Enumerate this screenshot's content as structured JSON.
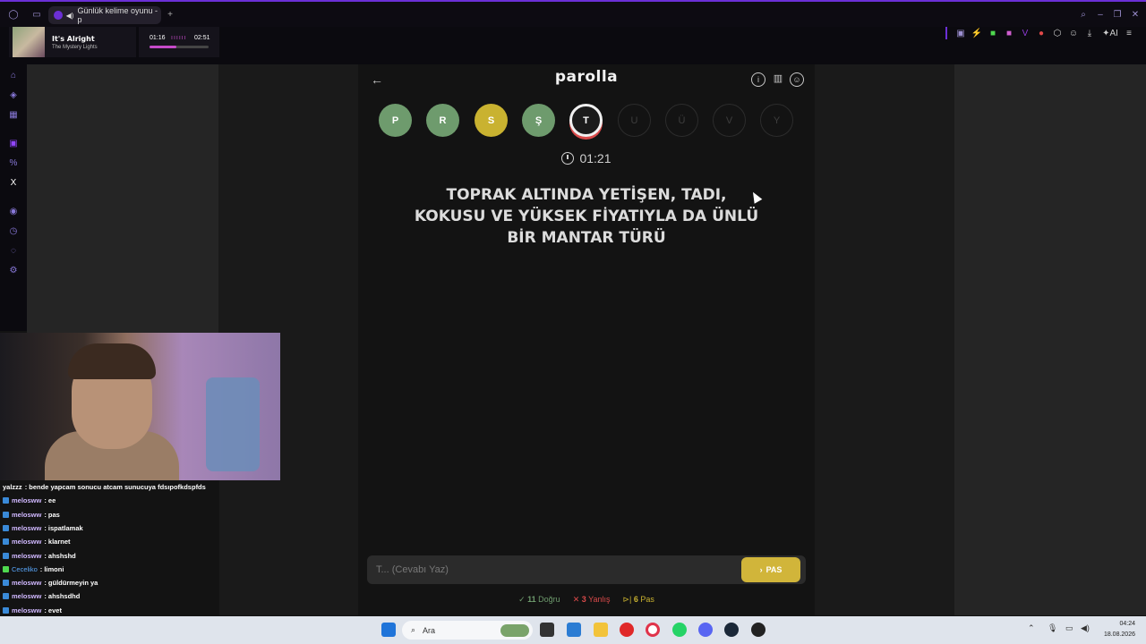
{
  "browser": {
    "tab_title": "Günlük kelime oyunu - p"
  },
  "player": {
    "title": "It's Alright",
    "artist": "The Mystery Lights",
    "elapsed": "01:16",
    "duration": "02:51",
    "progress": 0.45
  },
  "game": {
    "brand": "parolla",
    "letters": [
      {
        "char": "P",
        "state": "correct"
      },
      {
        "char": "R",
        "state": "correct"
      },
      {
        "char": "S",
        "state": "passed"
      },
      {
        "char": "Ş",
        "state": "correct"
      },
      {
        "char": "T",
        "state": "current"
      },
      {
        "char": "U",
        "state": "pending"
      },
      {
        "char": "Ü",
        "state": "pending"
      },
      {
        "char": "V",
        "state": "pending"
      },
      {
        "char": "Y",
        "state": "pending"
      }
    ],
    "timer": "01:21",
    "question": "TOPRAK ALTINDA YETİŞEN, TADI, KOKUSU VE YÜKSEK FİYATIYLA DA ÜNLÜ BİR MANTAR TÜRÜ",
    "answer_placeholder": "T... (Cevabı Yaz)",
    "pass_button": "PAS",
    "stats": {
      "correct_count": "11",
      "correct_label": "Doğru",
      "wrong_count": "3",
      "wrong_label": "Yanlış",
      "pass_count": "6",
      "pass_label": "Pas"
    },
    "colors": {
      "correct": "#6e9b6d",
      "passed": "#c9b230",
      "wrong": "#d94a4a"
    }
  },
  "chat": [
    {
      "user": "yalzzz",
      "text": " : bende yapcam sonucu atcam sunucuya fdsıpofkdspfds"
    },
    {
      "user": "melosww",
      "text": " : ee"
    },
    {
      "user": "melosww",
      "text": " : pas"
    },
    {
      "user": "melosww",
      "text": " : ispatlamak"
    },
    {
      "user": "melosww",
      "text": " : klarnet"
    },
    {
      "user": "melosww",
      "text": " : ahshshd"
    },
    {
      "user": "Ceceliko",
      "text": " : limoni"
    },
    {
      "user": "melosww",
      "text": " : güldürmeyin ya"
    },
    {
      "user": "melosww",
      "text": " : ahshsdhd"
    },
    {
      "user": "melosww",
      "text": " : evet"
    }
  ],
  "taskbar": {
    "search_label": "Ara",
    "time": "04:24",
    "date": "18.08.2026"
  }
}
